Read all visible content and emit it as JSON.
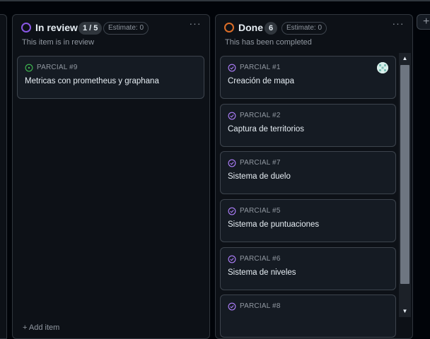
{
  "columns": [
    {
      "title": "In review",
      "count": "1 / 5",
      "estimate": "Estimate: 0",
      "description": "This item is in review",
      "status_color": "#8957e5",
      "cards": [
        {
          "ref": "PARCIAL #9",
          "title": "Metricas con prometheus y graphana",
          "status": "open"
        }
      ],
      "add_item_label": "+ Add item"
    },
    {
      "title": "Done",
      "count": "6",
      "estimate": "Estimate: 0",
      "description": "This has been completed",
      "status_color": "#db6d28",
      "cards": [
        {
          "ref": "PARCIAL #1",
          "title": "Creación de mapa",
          "status": "closed",
          "has_avatar": true
        },
        {
          "ref": "PARCIAL #2",
          "title": "Captura de territorios",
          "status": "closed"
        },
        {
          "ref": "PARCIAL #7",
          "title": "Sistema de duelo",
          "status": "closed"
        },
        {
          "ref": "PARCIAL #5",
          "title": "Sistema de puntuaciones",
          "status": "closed"
        },
        {
          "ref": "PARCIAL #6",
          "title": "Sistema de niveles",
          "status": "closed"
        },
        {
          "ref": "PARCIAL #8",
          "title": "",
          "status": "closed"
        }
      ]
    }
  ],
  "colors": {
    "open_issue": "#3fb950",
    "closed_issue": "#ab7df8"
  },
  "add_column_label": "+"
}
